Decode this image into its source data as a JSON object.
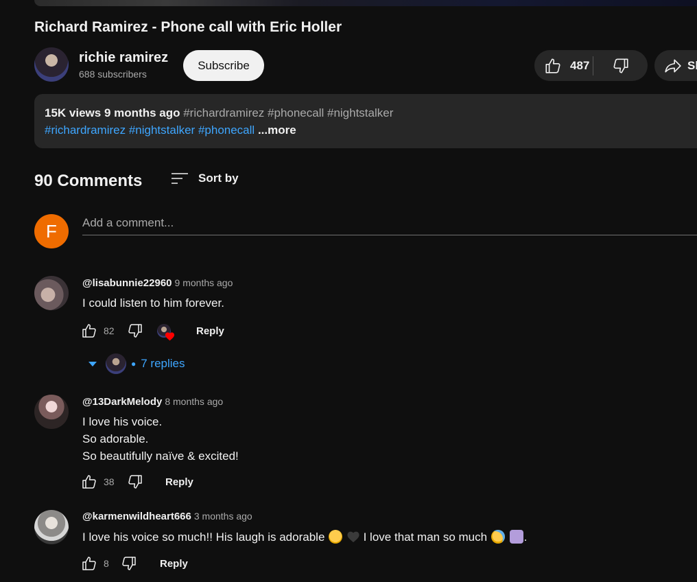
{
  "video": {
    "title": "Richard Ramirez - Phone call with Eric Holler"
  },
  "channel": {
    "name": "richie ramirez",
    "subscribers": "688 subscribers",
    "subscribe_label": "Subscribe"
  },
  "actions": {
    "like_count": "487",
    "share_label": "Sh"
  },
  "description": {
    "views": "15K views",
    "age": "9 months ago",
    "hashtags_line1": "#richardramirez #phonecall #nightstalker",
    "hashtags_line2": [
      "#richardramirez",
      "#nightstalker",
      "#phonecall"
    ],
    "more_label": "...more"
  },
  "comments_section": {
    "count_label": "90 Comments",
    "sort_label": "Sort by",
    "user_initial": "F",
    "add_comment_placeholder": "Add a comment..."
  },
  "comments": [
    {
      "author": "@lisabunnie22960",
      "time": "9 months ago",
      "lines": [
        "I could listen to him forever."
      ],
      "likes": "82",
      "reply_label": "Reply",
      "replies_label": "7 replies",
      "hearted": true
    },
    {
      "author": "@13DarkMelody",
      "time": "8 months ago",
      "lines": [
        "I love his voice.",
        "So adorable.",
        "So beautifully naïve & excited!"
      ],
      "likes": "38",
      "reply_label": "Reply"
    },
    {
      "author": "@karmenwildheart666",
      "time": "3 months ago",
      "text_part1": "I love his voice so much!! His laugh is adorable",
      "text_part2": "I love that man so much",
      "text_part3": ".",
      "likes": "8",
      "reply_label": "Reply"
    }
  ],
  "colors": {
    "background": "#0f0f0f",
    "link_blue": "#3ea6ff",
    "avatar_orange": "#ef6c00",
    "heart_red": "#ff0000"
  }
}
